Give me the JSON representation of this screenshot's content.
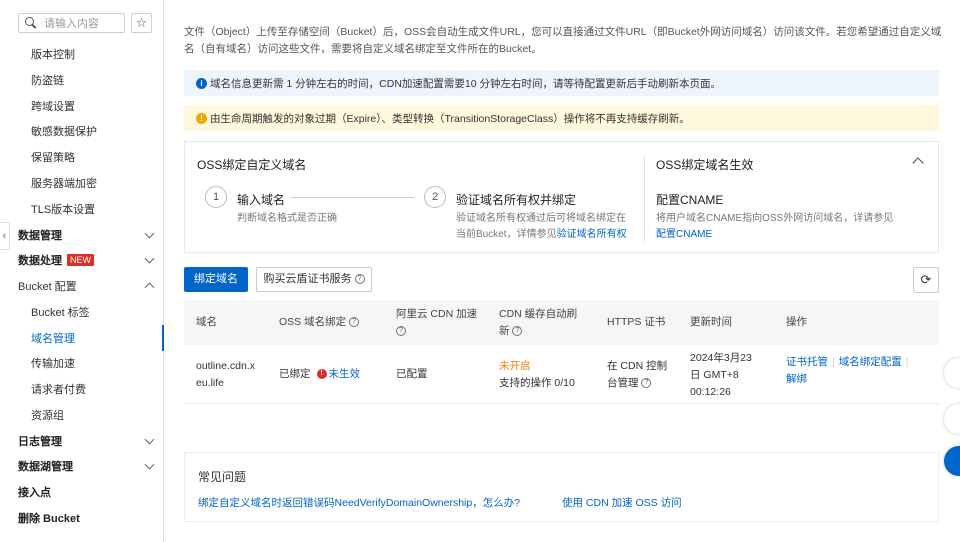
{
  "sidebar": {
    "search_placeholder": "请输入内容",
    "items": [
      {
        "label": "版本控制"
      },
      {
        "label": "防盗链"
      },
      {
        "label": "跨域设置"
      },
      {
        "label": "敏感数据保护"
      },
      {
        "label": "保留策略"
      },
      {
        "label": "服务器端加密"
      },
      {
        "label": "TLS版本设置"
      },
      {
        "label": "数据管理"
      },
      {
        "label": "数据处理",
        "badge": "NEW"
      },
      {
        "label": "Bucket 配置"
      },
      {
        "label": "Bucket 标签"
      },
      {
        "label": "域名管理"
      },
      {
        "label": "传输加速"
      },
      {
        "label": "请求者付费"
      },
      {
        "label": "资源组"
      },
      {
        "label": "日志管理"
      },
      {
        "label": "数据湖管理"
      },
      {
        "label": "接入点"
      },
      {
        "label": "删除 Bucket"
      }
    ]
  },
  "main": {
    "description": "文件（Object）上传至存储空间（Bucket）后，OSS会自动生成文件URL，您可以直接通过文件URL（即Bucket外网访问域名）访问该文件。若您希望通过自定义域名（自有域名）访问这些文件，需要将自定义域名绑定至文件所在的Bucket。",
    "notice_info": "域名信息更新需 1 分钟左右的时间，CDN加速配置需要10 分钟左右时间，请等待配置更新后手动刷新本页面。",
    "notice_warn": "由生命周期触发的对象过期（Expire）、类型转换（TransitionStorageClass）操作将不再支持缓存刷新。",
    "bind_card": {
      "title": "OSS绑定自定义域名",
      "step1": {
        "num": "1",
        "title": "输入域名",
        "desc": "判断域名格式是否正确"
      },
      "step2": {
        "num": "2",
        "title": "验证域名所有权并绑定",
        "desc": "验证域名所有权通过后可将域名绑定在当前Bucket，详情参见",
        "link": "验证域名所有权"
      },
      "right_title": "OSS绑定域名生效",
      "cname_title": "配置CNAME",
      "cname_desc": "将用户域名CNAME指向OSS外网访问域名，详请参见",
      "cname_link": "配置CNAME"
    },
    "toolbar": {
      "bind_label": "绑定域名",
      "buy_cert_label": "购买云盾证书服务"
    },
    "table": {
      "headers": [
        "域名",
        "OSS 域名绑定",
        "阿里云 CDN 加速",
        "CDN 缓存自动刷新",
        "HTTPS 证书",
        "更新时间",
        "操作"
      ],
      "row": {
        "domain": "outline.cdn.xeu.life",
        "oss_bind": "已绑定",
        "oss_status": "未生效",
        "cdn": "已配置",
        "refresh_status": "未开启",
        "refresh_ops": "支持的操作 0/10",
        "https": "在 CDN 控制台管理",
        "time": "2024年3月23日 GMT+8 00:12:26",
        "actions": [
          "证书托管",
          "域名绑定配置",
          "解绑"
        ]
      }
    },
    "faq": {
      "title": "常见问题",
      "links": [
        "绑定自定义域名时返回错误码NeedVerifyDomainOwnership，怎么办?",
        "使用 CDN 加速 OSS 访问"
      ]
    }
  }
}
